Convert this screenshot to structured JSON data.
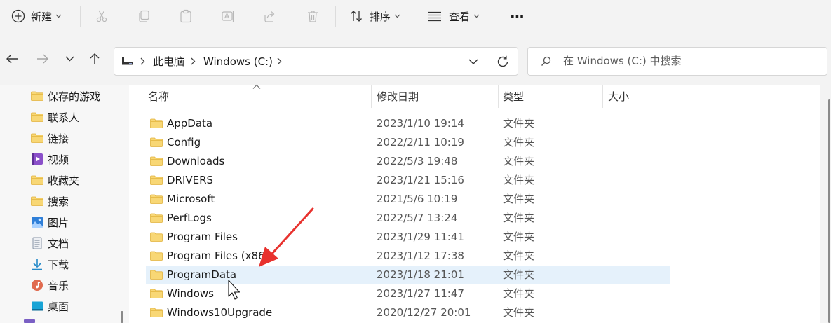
{
  "toolbar": {
    "new_label": "新建",
    "sort_label": "排序",
    "view_label": "查看",
    "more_label": "···"
  },
  "address": {
    "crumbs": [
      "此电脑",
      "Windows (C:)"
    ]
  },
  "search": {
    "placeholder": "在 Windows (C:) 中搜索"
  },
  "sidebar": {
    "items": [
      {
        "label": "保存的游戏",
        "icon": "folder-icon"
      },
      {
        "label": "联系人",
        "icon": "folder-icon"
      },
      {
        "label": "链接",
        "icon": "folder-icon"
      },
      {
        "label": "视频",
        "icon": "video-icon"
      },
      {
        "label": "收藏夹",
        "icon": "folder-icon"
      },
      {
        "label": "搜索",
        "icon": "folder-icon"
      },
      {
        "label": "图片",
        "icon": "pictures-icon"
      },
      {
        "label": "文档",
        "icon": "document-icon"
      },
      {
        "label": "下载",
        "icon": "download-icon"
      },
      {
        "label": "音乐",
        "icon": "music-icon"
      },
      {
        "label": "桌面",
        "icon": "desktop-icon"
      }
    ]
  },
  "columns": {
    "name": "名称",
    "date": "修改日期",
    "type": "类型",
    "size": "大小"
  },
  "files": [
    {
      "name": "AppData",
      "date": "2023/1/10 19:14",
      "type": "文件夹"
    },
    {
      "name": "Config",
      "date": "2022/2/11 10:19",
      "type": "文件夹"
    },
    {
      "name": "Downloads",
      "date": "2022/5/3 19:48",
      "type": "文件夹"
    },
    {
      "name": "DRIVERS",
      "date": "2023/1/21 15:16",
      "type": "文件夹"
    },
    {
      "name": "Microsoft",
      "date": "2021/5/6 10:19",
      "type": "文件夹"
    },
    {
      "name": "PerfLogs",
      "date": "2022/5/7 13:24",
      "type": "文件夹"
    },
    {
      "name": "Program Files",
      "date": "2023/1/29 11:41",
      "type": "文件夹"
    },
    {
      "name": "Program Files (x86)",
      "date": "2023/1/12 17:38",
      "type": "文件夹"
    },
    {
      "name": "ProgramData",
      "date": "2023/1/18 21:01",
      "type": "文件夹",
      "selected": true
    },
    {
      "name": "Windows",
      "date": "2023/1/27 11:47",
      "type": "文件夹"
    },
    {
      "name": "Windows10Upgrade",
      "date": "2020/12/27 20:01",
      "type": "文件夹"
    }
  ],
  "colors": {
    "selection": "#e5f1fb",
    "annotation_arrow": "#e8322e",
    "folder": "#f8d775"
  }
}
